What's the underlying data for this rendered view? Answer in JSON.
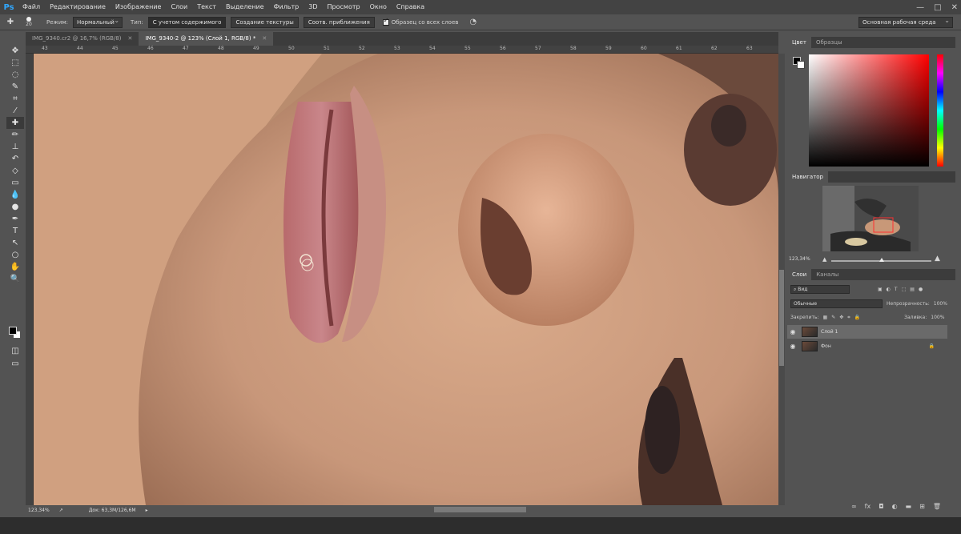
{
  "app": {
    "logo": "Ps"
  },
  "menu": [
    "Файл",
    "Редактирование",
    "Изображение",
    "Слои",
    "Текст",
    "Выделение",
    "Фильтр",
    "3D",
    "Просмотр",
    "Окно",
    "Справка"
  ],
  "window_controls": [
    "—",
    "□",
    "✕"
  ],
  "options": {
    "brush_size": "20",
    "mode_label": "Режим:",
    "mode_value": "Нормальный",
    "type_label": "Тип:",
    "type_buttons": [
      "С учетом содержимого",
      "Создание текстуры",
      "Соотв. приближения"
    ],
    "sample_all_layers": "Образец со всех слоев",
    "workspace": "Основная рабочая среда"
  },
  "tabs": [
    {
      "label": "IMG_9340.cr2 @ 16,7% (RGB/8)",
      "close": "✕"
    },
    {
      "label": "IMG_9340-2 @ 123% (Слой 1, RGB/8) *",
      "close": "✕"
    }
  ],
  "ruler_labels": [
    "43",
    "44",
    "45",
    "46",
    "47",
    "48",
    "49",
    "50",
    "51",
    "52",
    "53",
    "54",
    "55",
    "56",
    "57",
    "58",
    "59",
    "60",
    "61",
    "62",
    "63"
  ],
  "status": {
    "zoom": "123,34%",
    "doc": "Док: 63,3M/126,6M"
  },
  "tools": [
    {
      "icon": "move-icon",
      "glyph": "✥"
    },
    {
      "icon": "marquee-icon",
      "glyph": "⬚"
    },
    {
      "icon": "lasso-icon",
      "glyph": "◌"
    },
    {
      "icon": "quick-select-icon",
      "glyph": "✎"
    },
    {
      "icon": "crop-icon",
      "glyph": "⌗"
    },
    {
      "icon": "eyedropper-icon",
      "glyph": "⁄"
    },
    {
      "icon": "healing-brush-icon",
      "glyph": "✚"
    },
    {
      "icon": "brush-icon",
      "glyph": "✏"
    },
    {
      "icon": "stamp-icon",
      "glyph": "⊥"
    },
    {
      "icon": "history-brush-icon",
      "glyph": "↶"
    },
    {
      "icon": "eraser-icon",
      "glyph": "◇"
    },
    {
      "icon": "gradient-icon",
      "glyph": "▭"
    },
    {
      "icon": "blur-icon",
      "glyph": "💧"
    },
    {
      "icon": "dodge-icon",
      "glyph": "●"
    },
    {
      "icon": "pen-icon",
      "glyph": "✒"
    },
    {
      "icon": "type-icon",
      "glyph": "T"
    },
    {
      "icon": "path-select-icon",
      "glyph": "↖"
    },
    {
      "icon": "shape-icon",
      "glyph": "○"
    },
    {
      "icon": "hand-icon",
      "glyph": "✋"
    },
    {
      "icon": "zoom-icon",
      "glyph": "🔍"
    }
  ],
  "selected_tool": "healing-brush-icon",
  "color_panel": {
    "tabs": [
      "Цвет",
      "Образцы"
    ]
  },
  "navigator": {
    "tab": "Навигатор",
    "zoom": "123,34%"
  },
  "layers_panel": {
    "tabs": [
      "Слои",
      "Каналы"
    ],
    "filter": "Вид",
    "blend": "Обычные",
    "opacity_label": "Непрозрачность:",
    "opacity": "100%",
    "lock_label": "Закрепить:",
    "fill_label": "Заливка:",
    "fill": "100%",
    "layers": [
      {
        "name": "Слой 1",
        "selected": true
      },
      {
        "name": "Фон",
        "selected": false
      }
    ],
    "footer_icons": [
      "link-icon",
      "fx-icon",
      "mask-icon",
      "adjustment-icon",
      "folder-icon",
      "new-layer-icon",
      "trash-icon"
    ]
  }
}
